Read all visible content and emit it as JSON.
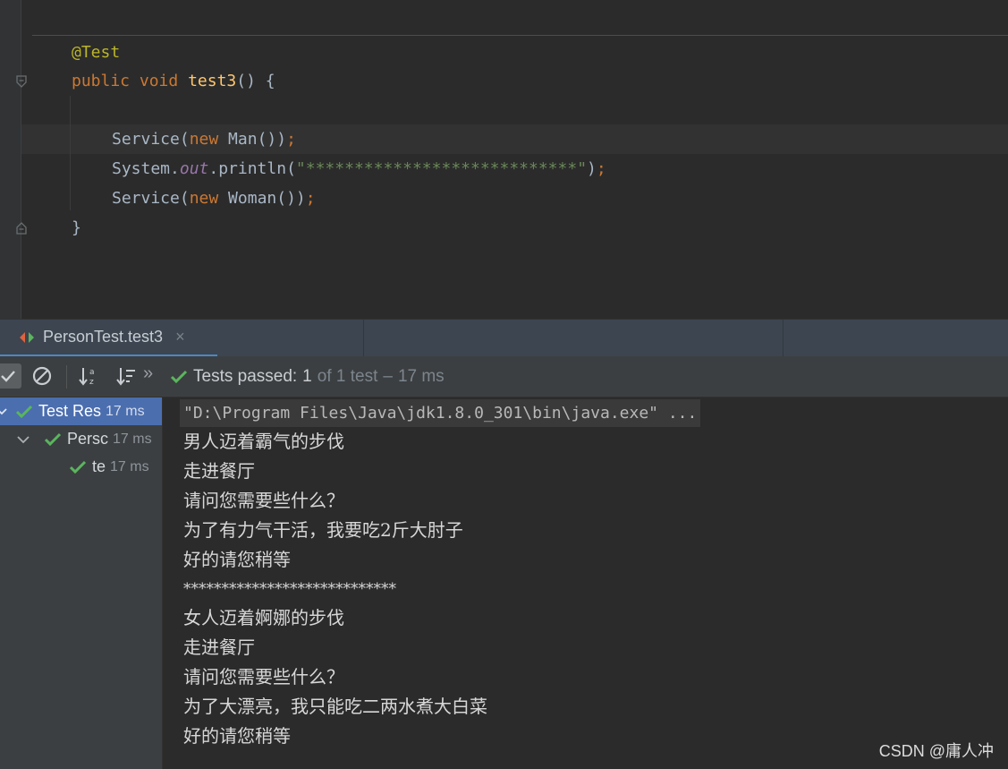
{
  "editor": {
    "annotation": "@Test",
    "method_signature": {
      "modifier": "public",
      "return_type": "void",
      "name": "test3",
      "suffix": "() {"
    },
    "lines": [
      {
        "callee": "Service(",
        "kw": "new",
        "tail": " Man())",
        "end": ";"
      },
      {
        "prefix": "System.",
        "field": "out",
        "call": ".println(",
        "string": "\"****************************\"",
        "close": ")",
        "end": ";"
      },
      {
        "callee": "Service(",
        "kw": "new",
        "tail": " Woman())",
        "end": ";"
      }
    ],
    "closing_brace": "}"
  },
  "run_tab": {
    "title": "PersonTest.test3",
    "close": "×"
  },
  "toolbar": {
    "more": "»",
    "status_label": "Tests passed:",
    "passed_count": "1",
    "total_text": "of 1 test",
    "dash": "–",
    "duration": "17 ms"
  },
  "tree": {
    "items": [
      {
        "label": "Test Res",
        "time": "17 ms",
        "expanded": true,
        "selected": true
      },
      {
        "label": "Persc",
        "time": "17 ms",
        "expanded": true,
        "selected": false
      },
      {
        "label": "te",
        "time": "17 ms",
        "selected": false
      }
    ]
  },
  "console": {
    "command": "\"D:\\Program Files\\Java\\jdk1.8.0_301\\bin\\java.exe\" ...",
    "output": [
      "男人迈着霸气的步伐",
      "走进餐厅",
      "请问您需要些什么？",
      "为了有力气干活，我要吃2斤大肘子",
      "好的请您稍等",
      "****************************",
      "女人迈着婀娜的步伐",
      "走进餐厅",
      "请问您需要些什么？",
      "为了大漂亮，我只能吃二两水煮大白菜",
      "好的请您稍等"
    ]
  },
  "watermark": "CSDN @庸人冲",
  "colors": {
    "editor_bg": "#2b2b2b",
    "keyword": "#cc7832",
    "method": "#ffc66d",
    "annotation": "#bbb529",
    "string": "#6a8759",
    "field": "#9876aa",
    "pass_green": "#5ab55e",
    "selection": "#4b6eaf"
  }
}
